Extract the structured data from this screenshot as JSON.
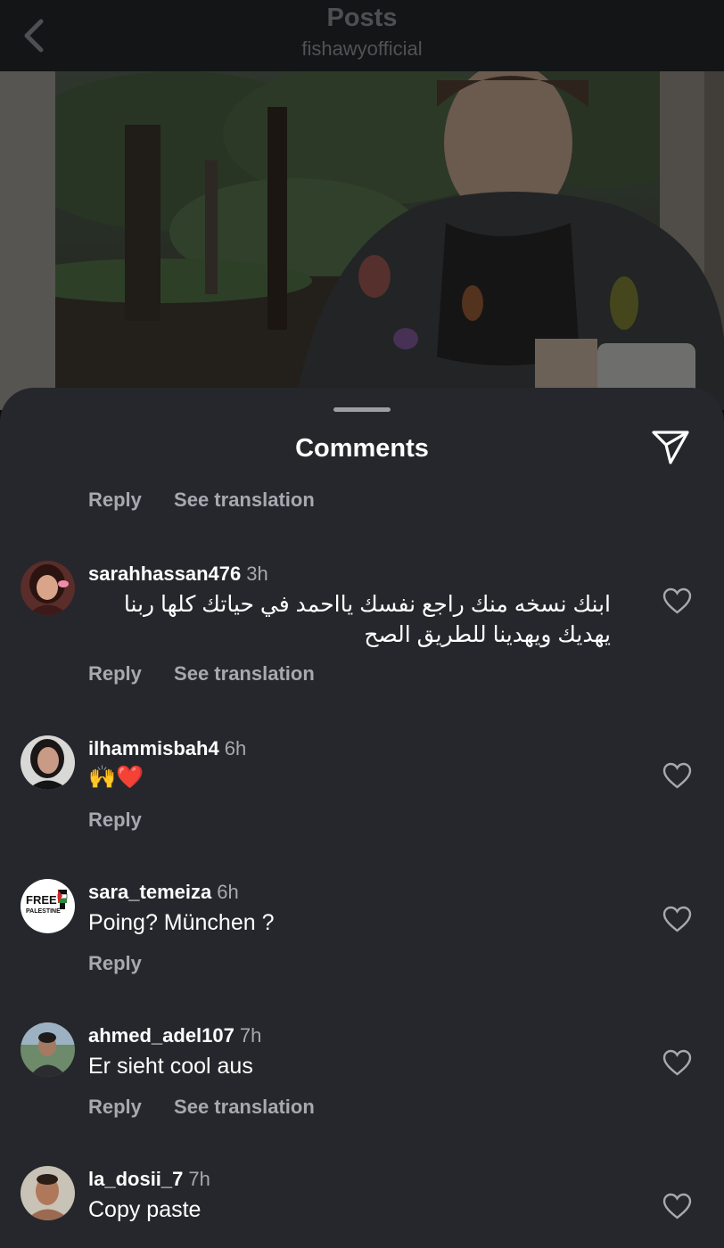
{
  "header": {
    "title": "Posts",
    "username": "fishawyofficial",
    "back_icon": "chevron-left-icon"
  },
  "sheet": {
    "title": "Comments",
    "share_icon": "send-icon"
  },
  "top_actions": {
    "reply": "Reply",
    "see_translation": "See translation"
  },
  "comments": [
    {
      "username": "sarahhassan476",
      "time": "3h",
      "text": "ابنك نسخه منك راجع نفسك يااحمد في حياتك كلها ربنا يهديك ويهدينا للطريق الصح",
      "reply": "Reply",
      "see_translation": "See translation"
    },
    {
      "username": "ilhammisbah4",
      "time": "6h",
      "text": "🙌❤️",
      "reply": "Reply"
    },
    {
      "username": "sara_temeiza",
      "time": "6h",
      "text": "Poing? München ?",
      "reply": "Reply",
      "avatar_text_1": "FREE",
      "avatar_text_2": "PALESTINE"
    },
    {
      "username": "ahmed_adel107",
      "time": "7h",
      "text": "Er sieht cool aus",
      "reply": "Reply",
      "see_translation": "See translation"
    },
    {
      "username": "la_dosii_7",
      "time": "7h",
      "text": "Copy paste"
    }
  ],
  "colors": {
    "sheet_bg": "#25272c",
    "secondary_text": "#a6a9b0",
    "primary_text": "#ffffff"
  }
}
